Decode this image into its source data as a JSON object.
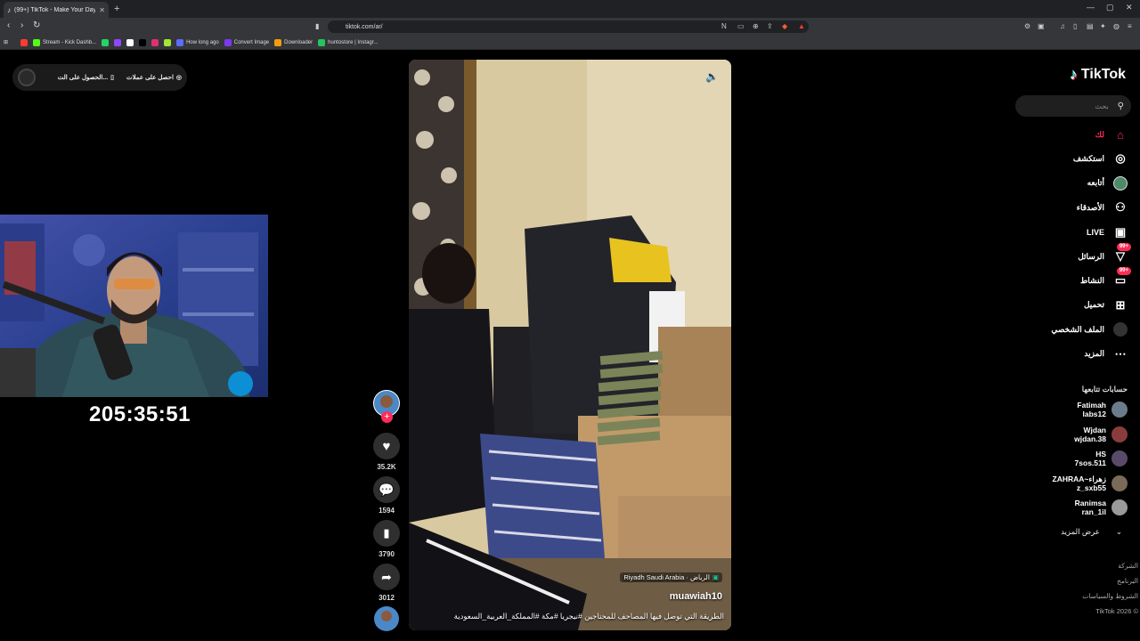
{
  "browser": {
    "tab_title": "(99+) TikTok - Make Your Day",
    "new_tab": "+",
    "url": "tiktok.com/ar/",
    "bookmarks": [
      {
        "label": "",
        "color": "#ff3b30"
      },
      {
        "label": "Stream - Kick Dashb...",
        "color": "#53fc18"
      },
      {
        "label": "",
        "color": "#25d366"
      },
      {
        "label": "",
        "color": "#9146ff"
      },
      {
        "label": "",
        "color": "#ffffff"
      },
      {
        "label": "",
        "color": "#000000"
      },
      {
        "label": "",
        "color": "#e1306c"
      },
      {
        "label": "",
        "color": "#a3e635"
      },
      {
        "label": "How long ago",
        "color": "#5b6cff"
      },
      {
        "label": "Convert Image",
        "color": "#7c3aed"
      },
      {
        "label": "Downloader",
        "color": "#f59e0b"
      },
      {
        "label": "huntostore | Instagr...",
        "color": "#22c55e"
      }
    ]
  },
  "overlay": {
    "pill_item_1": "احصل على عملات",
    "pill_item_2": "الحصول على الت...",
    "timer": "205:35:51"
  },
  "video": {
    "location": "Riyadh Saudi Arabia · الرياض",
    "username": "muawiah10",
    "caption": "الطريقة التي توصل فيها المصاحف للمحتاجين #نيجريا #مكة #المملكة_العربية_السعودية"
  },
  "actions": {
    "likes": "35.2K",
    "comments": "1594",
    "saves": "3790",
    "shares": "3012"
  },
  "sidebar": {
    "logo": "TikTok",
    "search_placeholder": "بحث",
    "nav": [
      {
        "label": "لك",
        "icon": "home-icon"
      },
      {
        "label": "استكشف",
        "icon": "compass-icon"
      },
      {
        "label": "أتابعه",
        "icon": "following-icon"
      },
      {
        "label": "الأصدقاء",
        "icon": "friends-icon"
      },
      {
        "label": "LIVE",
        "icon": "live-icon"
      },
      {
        "label": "الرسائل",
        "icon": "messages-icon",
        "badge": "99+"
      },
      {
        "label": "النشاط",
        "icon": "activity-icon",
        "badge": "99+"
      },
      {
        "label": "تحميل",
        "icon": "upload-icon"
      },
      {
        "label": "الملف الشخصي",
        "icon": "profile-icon"
      },
      {
        "label": "المزيد",
        "icon": "more-icon"
      }
    ],
    "following_title": "حسابات تتابعها",
    "following": [
      {
        "name": "Fatimah",
        "handle": "labs12"
      },
      {
        "name": "Wjdan",
        "handle": "wjdan.38"
      },
      {
        "name": "HS",
        "handle": "7sos.511"
      },
      {
        "name": "ZAHRAA~زهراء",
        "handle": "z_sxb55"
      },
      {
        "name": "Ranimsa",
        "handle": "ran_1il"
      }
    ],
    "see_more": "عرض المزيد",
    "footer": [
      "الشركة",
      "البرنامج",
      "الشروط والسياسات",
      "TikTok 2026 ©"
    ]
  }
}
